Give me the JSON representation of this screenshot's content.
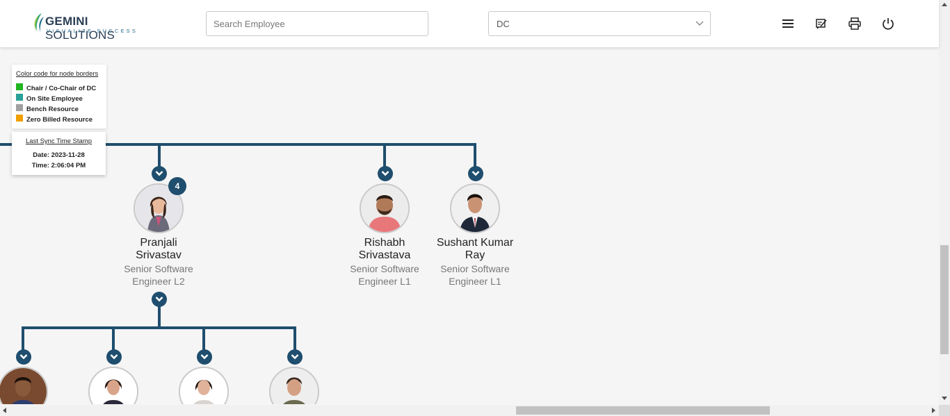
{
  "header": {
    "logo_title_bold": "GEMINI",
    "logo_title_rest": " SOLUTIONS",
    "logo_tagline": "VISUALIZE SUCCESS",
    "search_placeholder": "Search Employee",
    "department_selected": "DC",
    "icons": [
      "menu-icon",
      "edit-note-icon",
      "print-icon",
      "power-icon"
    ]
  },
  "legend": {
    "title": "Color code for node borders",
    "items": [
      {
        "label": "Chair / Co-Chair of DC",
        "color": "#22b422"
      },
      {
        "label": "On Site Employee",
        "color": "#2aa198"
      },
      {
        "label": "Bench Resource",
        "color": "#a0a0a0"
      },
      {
        "label": "Zero Billed Resource",
        "color": "#f0a000"
      }
    ]
  },
  "sync": {
    "title": "Last Sync Time Stamp",
    "date": "Date: 2023-11-28",
    "time": "Time: 2:06:04 PM"
  },
  "nodes": [
    {
      "name_line1": "Pranjali",
      "name_line2": "Srivastav",
      "role_line1": "Senior Software",
      "role_line2": "Engineer L2",
      "reports": "4"
    },
    {
      "name_line1": "Rishabh",
      "name_line2": "Srivastava",
      "role_line1": "Senior Software",
      "role_line2": "Engineer L1"
    },
    {
      "name_line1": "Sushant Kumar",
      "name_line2": "Ray",
      "role_line1": "Senior Software",
      "role_line2": "Engineer L1"
    }
  ],
  "colors": {
    "accent": "#1f4e6e",
    "background": "#f5f5f5"
  }
}
